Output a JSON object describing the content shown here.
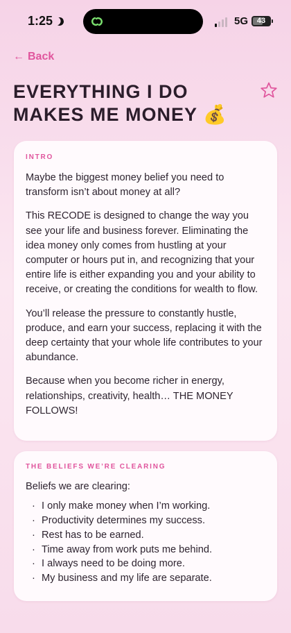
{
  "status_bar": {
    "time": "1:25",
    "network": "5G",
    "battery": "43",
    "icons": [
      "moon-icon",
      "app-link-icon",
      "cellular-signal-icon",
      "battery-icon"
    ]
  },
  "header": {
    "back_label": "Back",
    "title": "EVERYTHING I DO MAKES ME MONEY 💰",
    "icons": [
      "back-arrow-icon",
      "star-icon"
    ]
  },
  "intro": {
    "label": "INTRO",
    "paragraphs": [
      "Maybe the biggest money belief you need to transform isn’t about money at all?",
      "This RECODE is designed to change the way you see your life and business forever. Eliminating the idea money only comes from hustling at your computer or hours put in, and recognizing that your entire life is either expanding you and your ability to receive, or creating the conditions for wealth to flow.",
      "You’ll release the pressure to constantly hustle, produce, and earn your success, replacing it with the deep certainty that your whole life contributes to your abundance.",
      "Because when you become richer in energy, relationships, creativity, health… THE MONEY FOLLOWS!"
    ]
  },
  "beliefs": {
    "label": "THE BELIEFS WE’RE CLEARING",
    "lead": "Beliefs we are clearing:",
    "items": [
      "I only make money when I’m working.",
      "Productivity determines my success.",
      "Rest has to be earned.",
      "Time away from work puts me behind.",
      "I always need to be doing more.",
      "My business and my life are separate."
    ]
  },
  "colors": {
    "accent": "#e0559d",
    "background_top": "#f6d3e7",
    "card": "#fffafd",
    "text": "#2e2430"
  }
}
